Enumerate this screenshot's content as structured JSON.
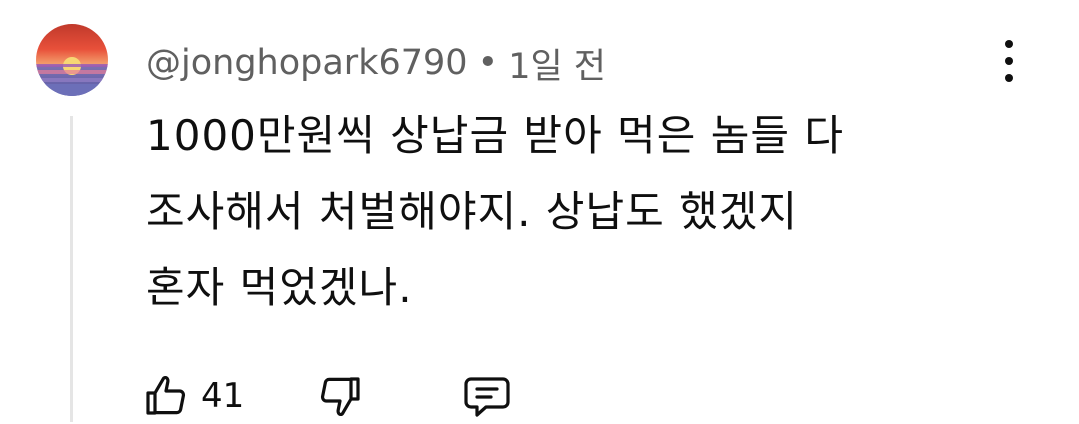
{
  "comment": {
    "author": "@jonghopark6790",
    "separator": "•",
    "time": "1일 전",
    "text_lines": [
      "1000만원씩 상납금 받아 먹은 놈들 다",
      "조사해서 처벌해야지. 상납도 했겠지",
      "혼자 먹었겠나."
    ],
    "like_count": "41"
  },
  "icons": {
    "avatar": "sunset-avatar",
    "more": "more-vertical-icon",
    "like": "thumbs-up-icon",
    "dislike": "thumbs-down-icon",
    "reply": "reply-comment-icon"
  },
  "colors": {
    "text": "#0f0f0f",
    "meta": "#606060",
    "thread_line": "#e5e5e5"
  }
}
